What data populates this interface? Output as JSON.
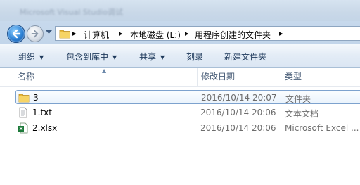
{
  "window": {
    "title": "Microsoft Visual Studio调试"
  },
  "address": {
    "crumbs": [
      "计算机",
      "本地磁盘 (L:)",
      "用程序创建的文件夹"
    ],
    "separator": "▸"
  },
  "toolbar": {
    "organize": "组织",
    "include_in_library": "包含到库中",
    "share": "共享",
    "burn": "刻录",
    "new_folder": "新建文件夹",
    "dropdown_arrow": "▼"
  },
  "columns": {
    "name": "名称",
    "modified": "修改日期",
    "type": "类型"
  },
  "files": [
    {
      "name": "3",
      "modified": "2016/10/14 20:07",
      "type": "文件夹",
      "icon": "folder-icon"
    },
    {
      "name": "1.txt",
      "modified": "2016/10/14 20:06",
      "type": "文本文档",
      "icon": "text-file-icon"
    },
    {
      "name": "2.xlsx",
      "modified": "2016/10/14 20:06",
      "type": "Microsoft Excel ...",
      "icon": "excel-file-icon"
    }
  ],
  "colors": {
    "accent": "#1e395b",
    "selection_border": "#7da2ce",
    "folder": "#e8b83a",
    "excel": "#1d7a3a"
  }
}
